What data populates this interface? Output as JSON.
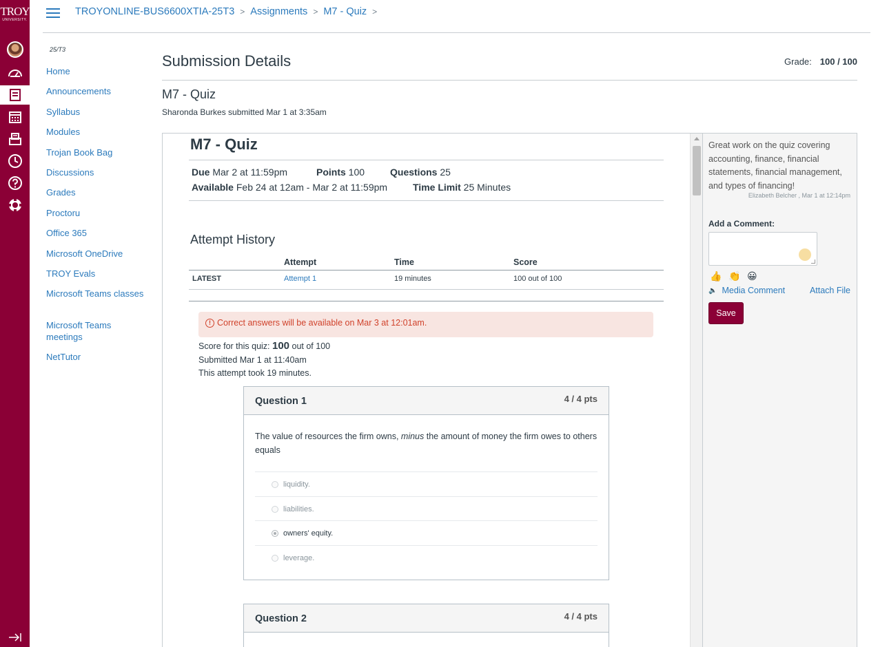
{
  "brand": {
    "logo_text": "TROY",
    "logo_sub": "UNIVERSITY."
  },
  "breadcrumbs": [
    "TROYONLINE-BUS6600XTIA-25T3",
    "Assignments",
    "M7 - Quiz"
  ],
  "course_nav": {
    "term": "25/T3",
    "items": [
      "Home",
      "Announcements",
      "Syllabus",
      "Modules",
      "Trojan Book Bag",
      "Discussions",
      "Grades",
      "Proctoru",
      "Office 365",
      "Microsoft OneDrive",
      "TROY Evals",
      "Microsoft Teams classes",
      "Microsoft Teams meetings",
      "NetTutor"
    ]
  },
  "submission": {
    "title": "Submission Details",
    "grade_label": "Grade:",
    "grade_value": "100 / 100",
    "quiz_name": "M7 - Quiz",
    "submitted_by": "Sharonda Burkes submitted Mar 1 at 3:35am"
  },
  "quiz": {
    "title": "M7 - Quiz",
    "due_label": "Due",
    "due_value": "Mar 2 at 11:59pm",
    "points_label": "Points",
    "points_value": "100",
    "questions_label": "Questions",
    "questions_value": "25",
    "available_label": "Available",
    "available_value": "Feb 24 at 12am - Mar 2 at 11:59pm",
    "time_limit_label": "Time Limit",
    "time_limit_value": "25 Minutes"
  },
  "attempt_history": {
    "title": "Attempt History",
    "columns": [
      "",
      "Attempt",
      "Time",
      "Score"
    ],
    "rows": [
      [
        "LATEST",
        "Attempt 1",
        "19 minutes",
        "100 out of 100"
      ]
    ]
  },
  "results": {
    "alert": "Correct answers will be available on Mar 3 at 12:01am.",
    "score_prefix": "Score for this quiz: ",
    "score_value": "100",
    "score_suffix": " out of 100",
    "submitted": "Submitted Mar 1 at 11:40am",
    "duration": "This attempt took 19 minutes."
  },
  "questions": [
    {
      "name": "Question 1",
      "pts": "4 / 4 pts",
      "text_before": "The value of resources the firm owns, ",
      "text_em": "minus",
      "text_after": " the amount of money the firm owes to others equals",
      "answers": [
        "liquidity.",
        "liabilities.",
        "owners' equity.",
        "leverage."
      ],
      "selected": 2
    },
    {
      "name": "Question 2",
      "pts": "4 / 4 pts"
    }
  ],
  "comments_panel": {
    "comment_text": "Great work on the quiz covering accounting, finance, financial statements, financial management, and types of financing!",
    "comment_author": "Elizabeth Belcher , Mar 1 at 12:14pm",
    "add_comment_label": "Add a Comment:",
    "media_comment": "Media Comment",
    "attach_file": "Attach File",
    "save_label": "Save"
  },
  "colors": {
    "brand": "#8b0036",
    "link": "#2b7abc",
    "alert_bg": "#f8e5e1",
    "alert_text": "#d0422b"
  }
}
